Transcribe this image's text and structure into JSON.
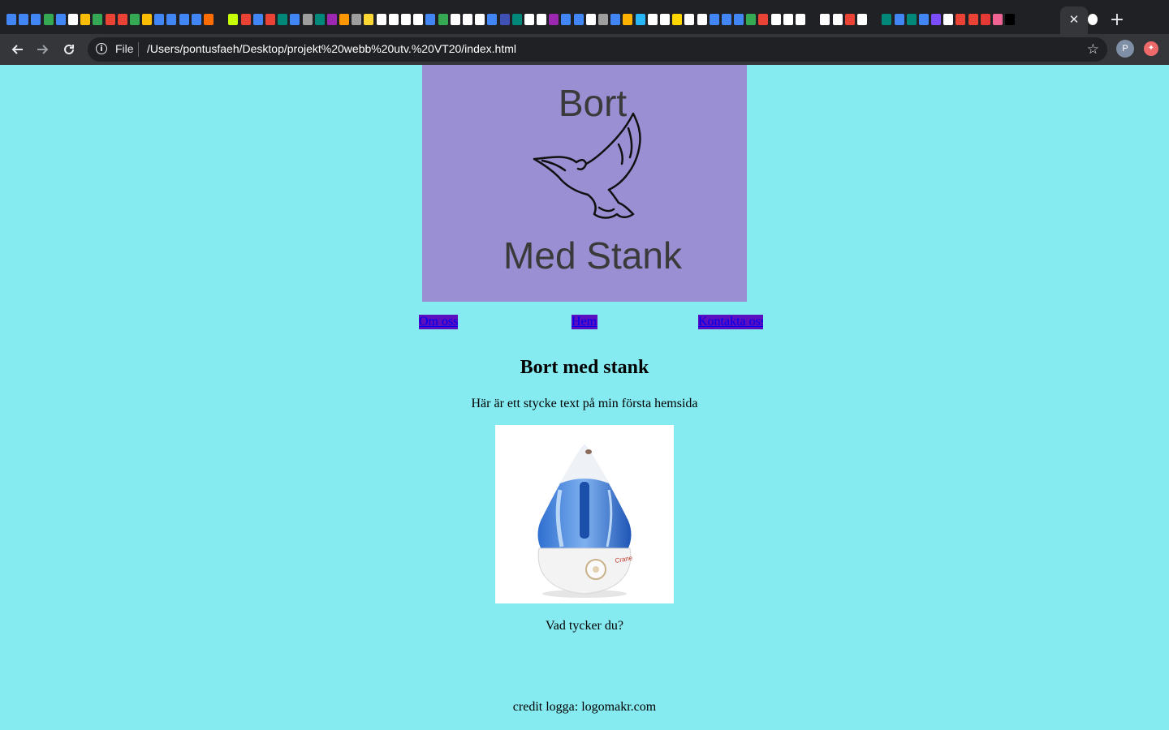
{
  "browser": {
    "scheme_label": "File",
    "url": "/Users/pontusfaeh/Desktop/projekt%20webb%20utv.%20VT20/index.html",
    "profile_initial": "P",
    "tab_close_glyph": "✕",
    "new_tab_glyph": "+",
    "icons": {
      "back": "arrow-left-icon",
      "forward": "arrow-right-icon",
      "reload": "reload-icon",
      "info": "info-icon",
      "bookmark": "star-icon",
      "extension": "extension-icon"
    }
  },
  "logo": {
    "line1": "Bort",
    "line2": "Med Stank",
    "image": "dove-icon",
    "background": "#9a8fd3"
  },
  "nav": {
    "items": [
      {
        "label": "Om oss"
      },
      {
        "label": "Hem"
      },
      {
        "label": "Kontakta oss"
      }
    ],
    "highlight_color": "#5b0fbf"
  },
  "main": {
    "title": "Bort med stank",
    "intro": "Här är ett stycke text på min första hemsida",
    "image": "humidifier-image",
    "question": "Vad tycker du?"
  },
  "footer": {
    "credit": "credit logga: logomakr.com"
  },
  "theme": {
    "page_background": "#86eaf1"
  }
}
